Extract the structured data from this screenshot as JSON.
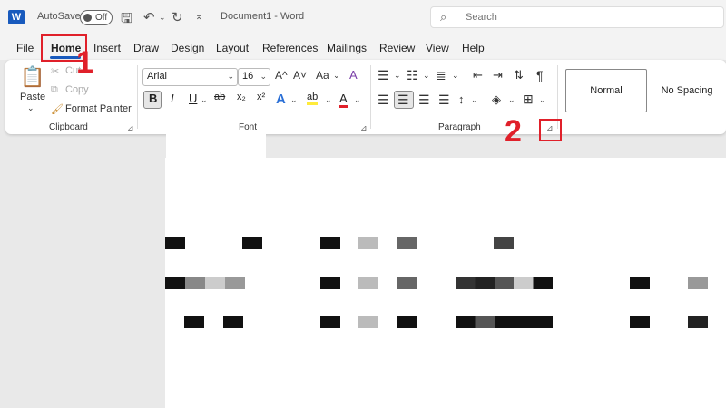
{
  "titlebar": {
    "logo": "W",
    "autosave_label": "AutoSave",
    "autosave_state": "Off",
    "doc_title": "Document1 - Word",
    "search_placeholder": "Search"
  },
  "menu": {
    "tabs": [
      "File",
      "Home",
      "Insert",
      "Draw",
      "Design",
      "Layout",
      "References",
      "Mailings",
      "Review",
      "View",
      "Help"
    ],
    "active": "Home"
  },
  "clipboard": {
    "paste": "Paste",
    "cut": "Cut",
    "copy": "Copy",
    "format_painter": "Format Painter",
    "label": "Clipboard"
  },
  "font": {
    "family": "Arial",
    "size": "16",
    "grow": "A^",
    "shrink": "A˅",
    "case": "Aa",
    "clear": "A",
    "bold": "B",
    "italic": "I",
    "underline": "U",
    "strike": "ab",
    "subscript": "x₂",
    "superscript": "x²",
    "effects": "A",
    "highlight": "ab",
    "color": "A",
    "label": "Font"
  },
  "paragraph": {
    "label": "Paragraph"
  },
  "styles": {
    "items": [
      "Normal",
      "No Spacing"
    ]
  },
  "annotations": {
    "step1": "1",
    "step2": "2"
  },
  "colors": {
    "accent": "#185abd",
    "annotation": "#e0202a",
    "highlight": "#ffeb3b",
    "font_color": "#e0202a"
  }
}
